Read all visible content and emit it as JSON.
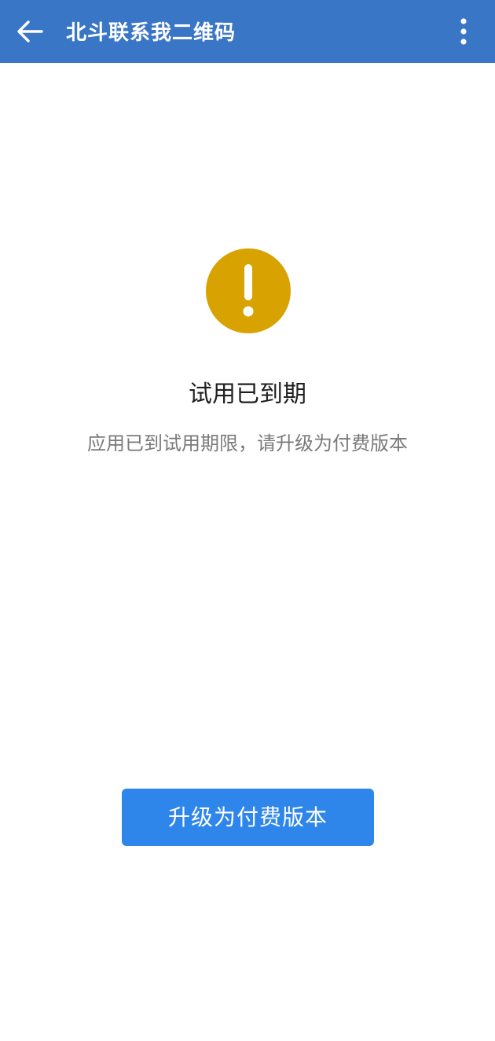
{
  "app_bar": {
    "title": "北斗联系我二维码",
    "back_icon": "arrow-left-icon",
    "more_icon": "more-vertical-icon",
    "background_color": "#3a76c6"
  },
  "status": {
    "icon": "warning-icon",
    "icon_color": "#d8a200",
    "heading": "试用已到期",
    "message": "应用已到试用期限，请升级为付费版本"
  },
  "actions": {
    "upgrade_label": "升级为付费版本",
    "button_color": "#2f86ea"
  }
}
